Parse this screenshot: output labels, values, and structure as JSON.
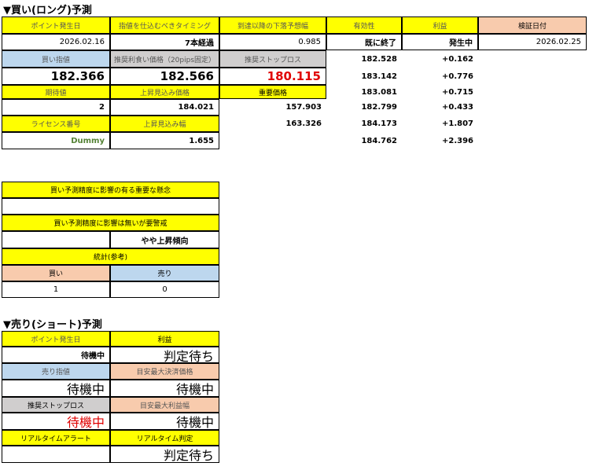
{
  "long": {
    "title": "▼買い(ロング)予測",
    "hdr_point_date": "ポイント発生日",
    "hdr_entry_timing": "指値を仕込むべきタイミング",
    "hdr_down_forecast": "到達以降の下落予想幅",
    "hdr_validity": "有効性",
    "hdr_profit": "利益",
    "hdr_verify_date": "検証日付",
    "point_date": "2026.02.16",
    "timing": "7本経過",
    "down_forecast": "0.985",
    "validity": "既に終了",
    "status": "発生中",
    "verify_date": "2026.02.25",
    "hdr_buy_limit": "買い指値",
    "hdr_take_profit": "推奨利食い価格（20pips固定）",
    "hdr_stop_loss": "推奨ストップロス",
    "buy_limit": "182.366",
    "take_profit": "182.566",
    "stop_loss": "180.115",
    "hdr_expected": "期待値",
    "hdr_upside_price": "上昇見込み価格",
    "hdr_key_price": "重要価格",
    "expected": "2",
    "upside_price": "184.021",
    "key_price_1": "157.903",
    "key_price_2": "163.326",
    "hdr_license": "ライセンス番号",
    "hdr_upside_width": "上昇見込み幅",
    "license": "Dummy",
    "upside_width": "1.655",
    "price_levels": [
      {
        "price": "182.528",
        "profit": "+0.162"
      },
      {
        "price": "183.142",
        "profit": "+0.776"
      },
      {
        "price": "183.081",
        "profit": "+0.715"
      },
      {
        "price": "182.799",
        "profit": "+0.433"
      },
      {
        "price": "184.173",
        "profit": "+1.807"
      },
      {
        "price": "184.762",
        "profit": "+2.396"
      }
    ]
  },
  "factors": {
    "hdr_high_impact": "買い予測精度に影響の有る重要な懸念",
    "high_impact_value": "",
    "hdr_low_impact": "買い予測精度に影響は無いが要警戒",
    "low_impact_value": "やや上昇傾向",
    "hdr_stats": "統計(参考)",
    "hdr_buy": "買い",
    "hdr_sell": "売り",
    "buy_count": "1",
    "sell_count": "0"
  },
  "short": {
    "title": "▼売り(ショート)予測",
    "hdr_point_date": "ポイント発生日",
    "hdr_profit": "利益",
    "point_date": "待機中",
    "profit": "判定待ち",
    "hdr_sell_limit": "売り指値",
    "hdr_max_settlement": "目安最大決済価格",
    "sell_limit": "待機中",
    "max_settlement": "待機中",
    "hdr_stop_loss": "推奨ストップロス",
    "hdr_max_profit": "目安最大利益幅",
    "stop_loss": "待機中",
    "max_profit": "待機中",
    "hdr_rt_alert": "リアルタイムアラート",
    "hdr_rt_judge": "リアルタイム判定",
    "rt_alert": "",
    "rt_judge": "判定待ち"
  }
}
